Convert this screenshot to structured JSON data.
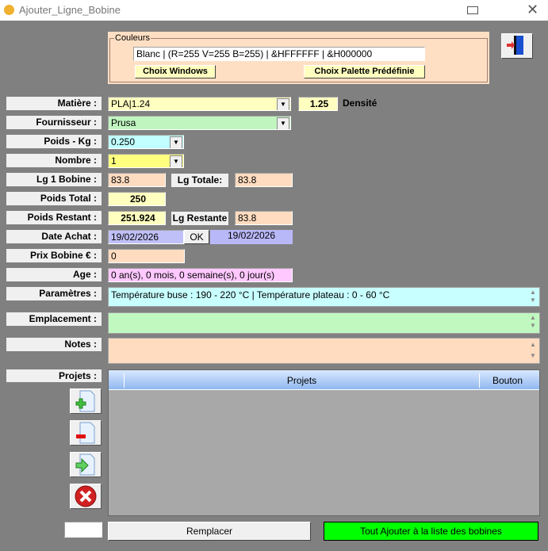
{
  "window": {
    "title": "Ajouter_Ligne_Bobine"
  },
  "couleurs": {
    "legend": "Couleurs",
    "value": "Blanc | (R=255 V=255 B=255) | &HFFFFFF | &H000000",
    "btn_windows": "Choix Windows",
    "btn_palette": "Choix Palette Prédéfinie"
  },
  "labels": {
    "matiere": "Matière :",
    "fournisseur": "Fournisseur :",
    "poids": "Poids - Kg :",
    "nombre": "Nombre :",
    "lg1": "Lg 1 Bobine :",
    "poids_total": "Poids Total :",
    "poids_restant": "Poids Restant :",
    "date_achat": "Date Achat :",
    "prix": "Prix Bobine € :",
    "age": "Age :",
    "parametres": "Paramètres :",
    "emplacement": "Emplacement :",
    "notes": "Notes :",
    "projets": "Projets :",
    "lg_totale": "Lg Totale:",
    "lg_restante": "Lg Restante",
    "densite": "Densité"
  },
  "values": {
    "matiere": "PLA|1.24",
    "densite": "1.25",
    "fournisseur": "Prusa",
    "poids": "0.250",
    "nombre": "1",
    "lg1": "83.8",
    "lg_totale": "83.8",
    "poids_total": "250",
    "poids_restant": "251.924",
    "lg_restante": "83.8",
    "date_achat": "19/02/2026",
    "date_display": "19/02/2026",
    "prix": "0",
    "age": "0 an(s), 0 mois, 0 semaine(s), 0 jour(s)",
    "parametres": "Température buse : 190 - 220 °C | Température plateau : 0 - 60 °C",
    "emplacement": "",
    "notes": "",
    "bottom_box": ""
  },
  "buttons": {
    "ok": "OK",
    "remplacer": "Remplacer",
    "tout_ajouter": "Tout Ajouter à la liste des bobines"
  },
  "grid": {
    "columns": [
      "Projets",
      "Bouton"
    ]
  }
}
